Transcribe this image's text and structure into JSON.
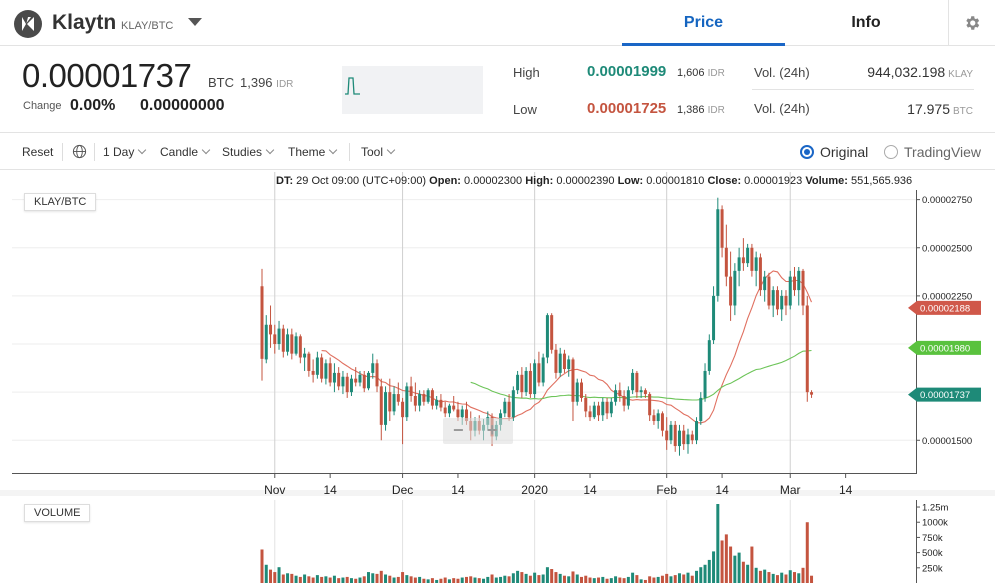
{
  "header": {
    "coin_name": "Klaytn",
    "pair": "KLAY/BTC",
    "tabs": [
      "Price",
      "Info"
    ],
    "active_tab": "Price"
  },
  "summary": {
    "price": "0.00001737",
    "price_unit": "BTC",
    "price_idr": "1,396",
    "idr_label": "IDR",
    "change_label": "Change",
    "change_pct": "0.00%",
    "change_abs": "0.00000000",
    "high_label": "High",
    "high_value": "0.00001999",
    "high_idr": "1,606",
    "low_label": "Low",
    "low_value": "0.00001725",
    "low_idr": "1,386",
    "vol_label_1": "Vol. (24h)",
    "vol_value_1": "944,032.198",
    "vol_unit_1": "KLAY",
    "vol_label_2": "Vol. (24h)",
    "vol_value_2": "17.975",
    "vol_unit_2": "BTC"
  },
  "toolbar": {
    "reset": "Reset",
    "interval": "1 Day",
    "chart_type": "Candle",
    "studies": "Studies",
    "theme": "Theme",
    "tool": "Tool",
    "radio_original": "Original",
    "radio_tradingview": "TradingView",
    "selected": "Original"
  },
  "ohlc": {
    "dt_label": "DT:",
    "dt_value": "29 Oct 09:00 (UTC+09:00)",
    "open_label": "Open:",
    "open_value": "0.00002300",
    "high_label": "High:",
    "high_value": "0.00002390",
    "low_label": "Low:",
    "low_value": "0.00001810",
    "close_label": "Close:",
    "close_value": "0.00001923",
    "volume_label": "Volume:",
    "volume_value": "551,565.936"
  },
  "colors": {
    "up": "#1e8a78",
    "down": "#c4543f",
    "ma_fast": "#e07060",
    "ma_slow": "#6cc458",
    "price_tag_last": "#1e8a78",
    "price_tag_red": "#d0584a",
    "price_tag_green": "#5ac23e",
    "tab_active": "#1a66c6"
  },
  "chart_data": {
    "type": "candlestick",
    "pair_label": "KLAY/BTC",
    "volume_label": "VOLUME",
    "x_tick_labels": [
      "Nov",
      "14",
      "Dec",
      "14",
      "2020",
      "14",
      "Feb",
      "14",
      "Mar",
      "14"
    ],
    "x_tick_bar_index": [
      3,
      16,
      33,
      46,
      64,
      77,
      95,
      108,
      124,
      137
    ],
    "y_ticks": [
      "0.00002750",
      "0.00002500",
      "0.00002250",
      "0.00001500"
    ],
    "y_tick_values": [
      2.75e-05,
      2.5e-05,
      2.25e-05,
      1.5e-05
    ],
    "ylim": [
      1.33e-05,
      2.8e-05
    ],
    "price_tags": [
      {
        "label": "0.00002188",
        "value": 2.188e-05,
        "color": "red"
      },
      {
        "label": "0.00001980",
        "value": 1.98e-05,
        "color": "green"
      },
      {
        "label": "0.00001737",
        "value": 1.737e-05,
        "color": "last"
      }
    ],
    "volume_ticks": [
      "1.25m",
      "1000k",
      "750k",
      "500k",
      "250k"
    ],
    "volume_tick_values": [
      1250000,
      1000000,
      750000,
      500000,
      250000
    ],
    "volume_max": 1300000,
    "bars": [
      [
        2.3e-05,
        2.39e-05,
        1.81e-05,
        1.923e-05,
        551566
      ],
      [
        1.92e-05,
        2.15e-05,
        1.9e-05,
        2.1e-05,
        300000
      ],
      [
        2.1e-05,
        2.2e-05,
        1.98e-05,
        2.05e-05,
        220000
      ],
      [
        2.05e-05,
        2.1e-05,
        1.95e-05,
        2e-05,
        180000
      ],
      [
        2e-05,
        2.12e-05,
        1.97e-05,
        2.08e-05,
        260000
      ],
      [
        2.08e-05,
        2.1e-05,
        1.93e-05,
        1.96e-05,
        140000
      ],
      [
        1.96e-05,
        2.08e-05,
        1.94e-05,
        2.05e-05,
        160000
      ],
      [
        2.05e-05,
        2.08e-05,
        1.92e-05,
        1.95e-05,
        150000
      ],
      [
        1.95e-05,
        2.06e-05,
        1.94e-05,
        2.04e-05,
        120000
      ],
      [
        2.04e-05,
        2.05e-05,
        1.9e-05,
        1.93e-05,
        100000
      ],
      [
        1.93e-05,
        1.98e-05,
        1.86e-05,
        1.95e-05,
        140000
      ],
      [
        1.95e-05,
        1.96e-05,
        1.83e-05,
        1.86e-05,
        110000
      ],
      [
        1.86e-05,
        1.92e-05,
        1.8e-05,
        1.84e-05,
        90000
      ],
      [
        1.84e-05,
        1.96e-05,
        1.82e-05,
        1.93e-05,
        130000
      ],
      [
        1.93e-05,
        1.95e-05,
        1.8e-05,
        1.82e-05,
        100000
      ],
      [
        1.82e-05,
        1.92e-05,
        1.79e-05,
        1.9e-05,
        110000
      ],
      [
        1.9e-05,
        1.93e-05,
        1.78e-05,
        1.8e-05,
        90000
      ],
      [
        1.8e-05,
        1.9e-05,
        1.75e-05,
        1.85e-05,
        120000
      ],
      [
        1.85e-05,
        1.88e-05,
        1.76e-05,
        1.78e-05,
        80000
      ],
      [
        1.78e-05,
        1.86e-05,
        1.74e-05,
        1.83e-05,
        90000
      ],
      [
        1.83e-05,
        1.85e-05,
        1.72e-05,
        1.75e-05,
        100000
      ],
      [
        1.75e-05,
        1.84e-05,
        1.73e-05,
        1.82e-05,
        80000
      ],
      [
        1.82e-05,
        1.88e-05,
        1.78e-05,
        1.8e-05,
        70000
      ],
      [
        1.8e-05,
        1.86e-05,
        1.78e-05,
        1.84e-05,
        90000
      ],
      [
        1.84e-05,
        1.86e-05,
        1.75e-05,
        1.77e-05,
        110000
      ],
      [
        1.77e-05,
        1.86e-05,
        1.76e-05,
        1.85e-05,
        180000
      ],
      [
        1.85e-05,
        1.95e-05,
        1.82e-05,
        1.9e-05,
        160000
      ],
      [
        1.9e-05,
        1.92e-05,
        1.75e-05,
        1.78e-05,
        150000
      ],
      [
        1.78e-05,
        1.82e-05,
        1.5e-05,
        1.58e-05,
        200000
      ],
      [
        1.58e-05,
        1.78e-05,
        1.55e-05,
        1.75e-05,
        140000
      ],
      [
        1.75e-05,
        1.82e-05,
        1.6e-05,
        1.65e-05,
        120000
      ],
      [
        1.65e-05,
        1.78e-05,
        1.63e-05,
        1.74e-05,
        90000
      ],
      [
        1.74e-05,
        1.8e-05,
        1.68e-05,
        1.7e-05,
        100000
      ],
      [
        1.7e-05,
        1.72e-05,
        1.48e-05,
        1.62e-05,
        180000
      ],
      [
        1.62e-05,
        1.8e-05,
        1.6e-05,
        1.78e-05,
        130000
      ],
      [
        1.78e-05,
        1.83e-05,
        1.7e-05,
        1.73e-05,
        110000
      ],
      [
        1.73e-05,
        1.8e-05,
        1.65e-05,
        1.68e-05,
        90000
      ],
      [
        1.68e-05,
        1.76e-05,
        1.65e-05,
        1.74e-05,
        100000
      ],
      [
        1.74e-05,
        1.76e-05,
        1.68e-05,
        1.7e-05,
        70000
      ],
      [
        1.7e-05,
        1.77e-05,
        1.69e-05,
        1.76e-05,
        60000
      ],
      [
        1.76e-05,
        1.77e-05,
        1.66e-05,
        1.68e-05,
        80000
      ],
      [
        1.68e-05,
        1.73e-05,
        1.66e-05,
        1.71e-05,
        50000
      ],
      [
        1.71e-05,
        1.74e-05,
        1.65e-05,
        1.67e-05,
        70000
      ],
      [
        1.67e-05,
        1.7e-05,
        1.62e-05,
        1.64e-05,
        90000
      ],
      [
        1.64e-05,
        1.69e-05,
        1.62e-05,
        1.68e-05,
        60000
      ],
      [
        1.68e-05,
        1.73e-05,
        1.65e-05,
        1.66e-05,
        80000
      ],
      [
        1.66e-05,
        1.7e-05,
        1.6e-05,
        1.62e-05,
        70000
      ],
      [
        1.62e-05,
        1.68e-05,
        1.58e-05,
        1.66e-05,
        90000
      ],
      [
        1.66e-05,
        1.7e-05,
        1.58e-05,
        1.6e-05,
        100000
      ],
      [
        1.6e-05,
        1.65e-05,
        1.5e-05,
        1.55e-05,
        110000
      ],
      [
        1.55e-05,
        1.62e-05,
        1.52e-05,
        1.6e-05,
        90000
      ],
      [
        1.6e-05,
        1.63e-05,
        1.53e-05,
        1.55e-05,
        80000
      ],
      [
        1.55e-05,
        1.61e-05,
        1.5e-05,
        1.58e-05,
        70000
      ],
      [
        1.58e-05,
        1.65e-05,
        1.55e-05,
        1.62e-05,
        100000
      ],
      [
        1.62e-05,
        1.64e-05,
        1.47e-05,
        1.52e-05,
        140000
      ],
      [
        1.52e-05,
        1.6e-05,
        1.5e-05,
        1.58e-05,
        90000
      ],
      [
        1.58e-05,
        1.66e-05,
        1.55e-05,
        1.64e-05,
        100000
      ],
      [
        1.64e-05,
        1.72e-05,
        1.62e-05,
        1.7e-05,
        120000
      ],
      [
        1.7e-05,
        1.74e-05,
        1.6e-05,
        1.62e-05,
        110000
      ],
      [
        1.62e-05,
        1.78e-05,
        1.6e-05,
        1.76e-05,
        160000
      ],
      [
        1.76e-05,
        1.86e-05,
        1.74e-05,
        1.84e-05,
        200000
      ],
      [
        1.84e-05,
        1.88e-05,
        1.72e-05,
        1.75e-05,
        180000
      ],
      [
        1.75e-05,
        1.88e-05,
        1.73e-05,
        1.86e-05,
        150000
      ],
      [
        1.86e-05,
        1.9e-05,
        1.72e-05,
        1.74e-05,
        120000
      ],
      [
        1.74e-05,
        1.92e-05,
        1.72e-05,
        1.9e-05,
        170000
      ],
      [
        1.9e-05,
        1.96e-05,
        1.78e-05,
        1.8e-05,
        130000
      ],
      [
        1.8e-05,
        1.95e-05,
        1.78e-05,
        1.93e-05,
        140000
      ],
      [
        1.93e-05,
        2.16e-05,
        1.9e-05,
        2.15e-05,
        260000
      ],
      [
        2.15e-05,
        2.16e-05,
        1.95e-05,
        1.97e-05,
        230000
      ],
      [
        1.97e-05,
        2e-05,
        1.82e-05,
        1.85e-05,
        180000
      ],
      [
        1.85e-05,
        1.98e-05,
        1.83e-05,
        1.95e-05,
        150000
      ],
      [
        1.95e-05,
        1.97e-05,
        1.85e-05,
        1.87e-05,
        120000
      ],
      [
        1.87e-05,
        1.94e-05,
        1.83e-05,
        1.92e-05,
        110000
      ],
      [
        1.92e-05,
        1.93e-05,
        1.6e-05,
        1.7e-05,
        190000
      ],
      [
        1.7e-05,
        1.82e-05,
        1.68e-05,
        1.8e-05,
        140000
      ],
      [
        1.8e-05,
        1.82e-05,
        1.7e-05,
        1.72e-05,
        100000
      ],
      [
        1.72e-05,
        1.74e-05,
        1.62e-05,
        1.65e-05,
        120000
      ],
      [
        1.65e-05,
        1.68e-05,
        1.6e-05,
        1.62e-05,
        90000
      ],
      [
        1.62e-05,
        1.7e-05,
        1.61e-05,
        1.68e-05,
        80000
      ],
      [
        1.68e-05,
        1.7e-05,
        1.6e-05,
        1.63e-05,
        90000
      ],
      [
        1.63e-05,
        1.72e-05,
        1.6e-05,
        1.7e-05,
        100000
      ],
      [
        1.7e-05,
        1.72e-05,
        1.61e-05,
        1.64e-05,
        70000
      ],
      [
        1.64e-05,
        1.72e-05,
        1.62e-05,
        1.7e-05,
        80000
      ],
      [
        1.7e-05,
        1.79e-05,
        1.68e-05,
        1.76e-05,
        110000
      ],
      [
        1.76e-05,
        1.8e-05,
        1.7e-05,
        1.73e-05,
        90000
      ],
      [
        1.73e-05,
        1.76e-05,
        1.65e-05,
        1.68e-05,
        80000
      ],
      [
        1.68e-05,
        1.78e-05,
        1.66e-05,
        1.76e-05,
        100000
      ],
      [
        1.76e-05,
        1.87e-05,
        1.74e-05,
        1.85e-05,
        170000
      ],
      [
        1.85e-05,
        1.86e-05,
        1.72e-05,
        1.75e-05,
        130000
      ],
      [
        1.75e-05,
        1.78e-05,
        1.72e-05,
        1.76e-05,
        60000
      ],
      [
        1.76e-05,
        1.77e-05,
        1.72e-05,
        1.74e-05,
        50000
      ],
      [
        1.74e-05,
        1.75e-05,
        1.6e-05,
        1.63e-05,
        110000
      ],
      [
        1.63e-05,
        1.66e-05,
        1.58e-05,
        1.6e-05,
        90000
      ],
      [
        1.6e-05,
        1.66e-05,
        1.56e-05,
        1.64e-05,
        100000
      ],
      [
        1.64e-05,
        1.65e-05,
        1.52e-05,
        1.55e-05,
        120000
      ],
      [
        1.55e-05,
        1.62e-05,
        1.45e-05,
        1.5e-05,
        150000
      ],
      [
        1.5e-05,
        1.6e-05,
        1.48e-05,
        1.58e-05,
        110000
      ],
      [
        1.58e-05,
        1.6e-05,
        1.44e-05,
        1.47e-05,
        130000
      ],
      [
        1.47e-05,
        1.58e-05,
        1.42e-05,
        1.55e-05,
        160000
      ],
      [
        1.55e-05,
        1.58e-05,
        1.45e-05,
        1.48e-05,
        140000
      ],
      [
        1.48e-05,
        1.56e-05,
        1.43e-05,
        1.53e-05,
        170000
      ],
      [
        1.53e-05,
        1.55e-05,
        1.48e-05,
        1.5e-05,
        120000
      ],
      [
        1.5e-05,
        1.62e-05,
        1.48e-05,
        1.6e-05,
        200000
      ],
      [
        1.6e-05,
        1.75e-05,
        1.58e-05,
        1.72e-05,
        260000
      ],
      [
        1.72e-05,
        1.9e-05,
        1.7e-05,
        1.86e-05,
        300000
      ],
      [
        1.86e-05,
        2.05e-05,
        1.84e-05,
        2.02e-05,
        380000
      ],
      [
        2.02e-05,
        2.3e-05,
        2e-05,
        2.25e-05,
        520000
      ],
      [
        2.25e-05,
        2.76e-05,
        2.22e-05,
        2.7e-05,
        1300000
      ],
      [
        2.7e-05,
        2.72e-05,
        2.45e-05,
        2.5e-05,
        700000
      ],
      [
        2.5e-05,
        2.62e-05,
        2.3e-05,
        2.35e-05,
        800000
      ],
      [
        2.35e-05,
        2.48e-05,
        2.12e-05,
        2.2e-05,
        600000
      ],
      [
        2.2e-05,
        2.42e-05,
        2.15e-05,
        2.38e-05,
        450000
      ],
      [
        2.38e-05,
        2.5e-05,
        2.3e-05,
        2.45e-05,
        500000
      ],
      [
        2.45e-05,
        2.55e-05,
        2.38e-05,
        2.42e-05,
        350000
      ],
      [
        2.42e-05,
        2.52e-05,
        2.4e-05,
        2.5e-05,
        300000
      ],
      [
        2.5e-05,
        2.52e-05,
        2.35e-05,
        2.38e-05,
        600000
      ],
      [
        2.38e-05,
        2.48e-05,
        2.3e-05,
        2.45e-05,
        250000
      ],
      [
        2.45e-05,
        2.47e-05,
        2.25e-05,
        2.28e-05,
        200000
      ],
      [
        2.28e-05,
        2.38e-05,
        2.22e-05,
        2.35e-05,
        220000
      ],
      [
        2.35e-05,
        2.37e-05,
        2.18e-05,
        2.2e-05,
        180000
      ],
      [
        2.2e-05,
        2.3e-05,
        2.14e-05,
        2.28e-05,
        150000
      ],
      [
        2.28e-05,
        2.3e-05,
        2.15e-05,
        2.18e-05,
        130000
      ],
      [
        2.18e-05,
        2.28e-05,
        2.12e-05,
        2.25e-05,
        170000
      ],
      [
        2.25e-05,
        2.28e-05,
        2.15e-05,
        2.2e-05,
        140000
      ],
      [
        2.2e-05,
        2.38e-05,
        2.18e-05,
        2.35e-05,
        210000
      ],
      [
        2.35e-05,
        2.4e-05,
        2.25e-05,
        2.28e-05,
        180000
      ],
      [
        2.28e-05,
        2.4e-05,
        2.2e-05,
        2.38e-05,
        160000
      ],
      [
        2.38e-05,
        2.39e-05,
        2.15e-05,
        2.2e-05,
        250000
      ],
      [
        2.2e-05,
        2.25e-05,
        1.7e-05,
        1.75e-05,
        1000000
      ],
      [
        1.75e-05,
        1.76e-05,
        1.72e-05,
        1.737e-05,
        120000
      ]
    ]
  }
}
